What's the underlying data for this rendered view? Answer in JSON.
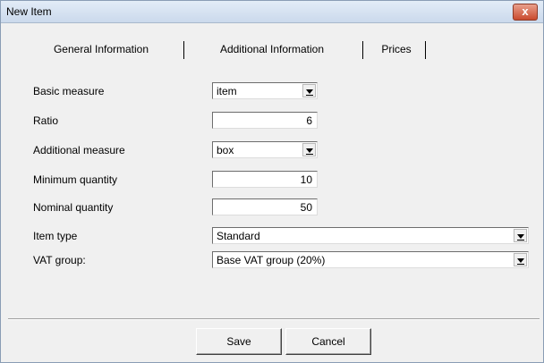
{
  "window": {
    "title": "New Item",
    "close_label": "x"
  },
  "tabs": [
    {
      "label": "General Information"
    },
    {
      "label": "Additional Information"
    },
    {
      "label": "Prices"
    }
  ],
  "form": {
    "basic_measure": {
      "label": "Basic measure",
      "value": "item"
    },
    "ratio": {
      "label": "Ratio",
      "value": "6"
    },
    "additional_measure": {
      "label": "Additional measure",
      "value": "box"
    },
    "minimum_quantity": {
      "label": "Minimum quantity",
      "value": "10"
    },
    "nominal_quantity": {
      "label": "Nominal quantity",
      "value": "50"
    },
    "item_type": {
      "label": "Item type",
      "value": "Standard"
    },
    "vat_group": {
      "label": "VAT group:",
      "value": "Base VAT group (20%)"
    }
  },
  "buttons": {
    "save": "Save",
    "cancel": "Cancel"
  },
  "colors": {
    "titlebar": "#cbd9ec",
    "close": "#c94a2e",
    "background": "#f0f0f0"
  }
}
